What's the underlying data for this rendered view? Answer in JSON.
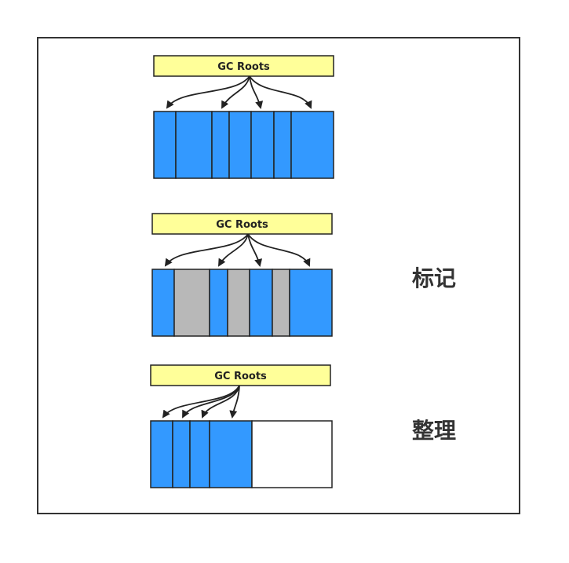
{
  "colors": {
    "live": "#3399ff",
    "dead": "#b8b8b8",
    "free": "#ffffff",
    "roots_fill": "#ffff99",
    "stroke": "#222222",
    "frame": "#333333"
  },
  "stages": [
    {
      "roots_label": "GC Roots",
      "stage_label": "",
      "blocks": [
        "live",
        "live",
        "live",
        "live",
        "live",
        "live",
        "live"
      ]
    },
    {
      "roots_label": "GC Roots",
      "stage_label": "标记",
      "blocks": [
        "live",
        "dead",
        "live",
        "dead",
        "live",
        "dead",
        "live"
      ]
    },
    {
      "roots_label": "GC Roots",
      "stage_label": "整理",
      "blocks": [
        "live",
        "live",
        "live",
        "live",
        "free"
      ]
    }
  ]
}
